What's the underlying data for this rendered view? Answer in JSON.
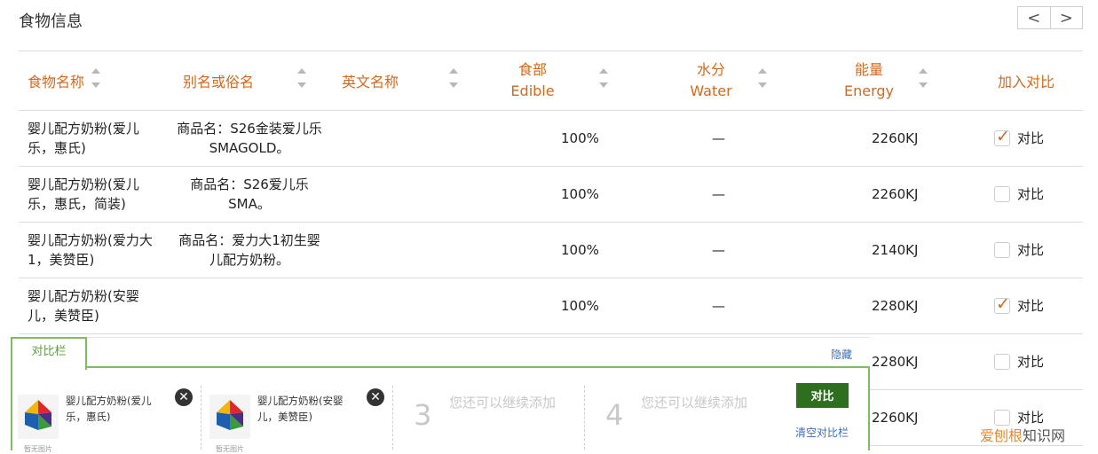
{
  "header": {
    "title": "食物信息",
    "prev_label": "<",
    "next_label": ">"
  },
  "table": {
    "columns": [
      {
        "label": "食物名称",
        "label2": ""
      },
      {
        "label": "别名或俗名",
        "label2": ""
      },
      {
        "label": "英文名称",
        "label2": ""
      },
      {
        "label": "食部",
        "label2": "Edible"
      },
      {
        "label": "水分",
        "label2": "Water"
      },
      {
        "label": "能量",
        "label2": "Energy"
      },
      {
        "label": "加入对比",
        "label2": ""
      }
    ],
    "compare_label": "对比",
    "rows": [
      {
        "name": "婴儿配方奶粉(爱儿乐，惠氏)",
        "alias": "商品名：S26金装爱儿乐SMAGOLD。",
        "english": "",
        "edible": "100%",
        "water": "—",
        "energy": "2260KJ",
        "checked": true
      },
      {
        "name": "婴儿配方奶粉(爱儿乐，惠氏，简装)",
        "alias": "商品名：S26爱儿乐SMA。",
        "english": "",
        "edible": "100%",
        "water": "—",
        "energy": "2260KJ",
        "checked": false
      },
      {
        "name": "婴儿配方奶粉(爱力大1，美赞臣)",
        "alias": "商品名：爱力大1初生婴儿配方奶粉。",
        "english": "",
        "edible": "100%",
        "water": "—",
        "energy": "2140KJ",
        "checked": false
      },
      {
        "name": "婴儿配方奶粉(安婴儿，美赞臣)",
        "alias": "",
        "english": "",
        "edible": "100%",
        "water": "—",
        "energy": "2280KJ",
        "checked": true
      },
      {
        "name": "",
        "alias": "",
        "english": "",
        "edible": "",
        "water": "",
        "energy": "2280KJ",
        "checked": false
      },
      {
        "name": "",
        "alias": "",
        "english": "",
        "edible": "",
        "water": "",
        "energy": "2260KJ",
        "checked": false
      }
    ]
  },
  "compare_panel": {
    "tab_label": "对比栏",
    "hide_label": "隐藏",
    "slots": [
      {
        "name": "婴儿配方奶粉(爱儿乐，惠氏)",
        "thumb_caption": "暂无图片"
      },
      {
        "name": "婴儿配方奶粉(安婴儿，美赞臣)",
        "thumb_caption": "暂无图片"
      },
      {
        "number": "3",
        "hint": "您还可以继续添加"
      },
      {
        "number": "4",
        "hint": "您还可以继续添加"
      }
    ],
    "compare_button": "对比",
    "clear_label": "清空对比栏"
  },
  "watermark": {
    "part1": "爱刨根",
    "part2": "知识网"
  },
  "colors": {
    "accent_orange": "#d2691e",
    "panel_green": "#7bbf5f",
    "button_green": "#2e6e1f",
    "link_blue": "#3f6fb5"
  }
}
